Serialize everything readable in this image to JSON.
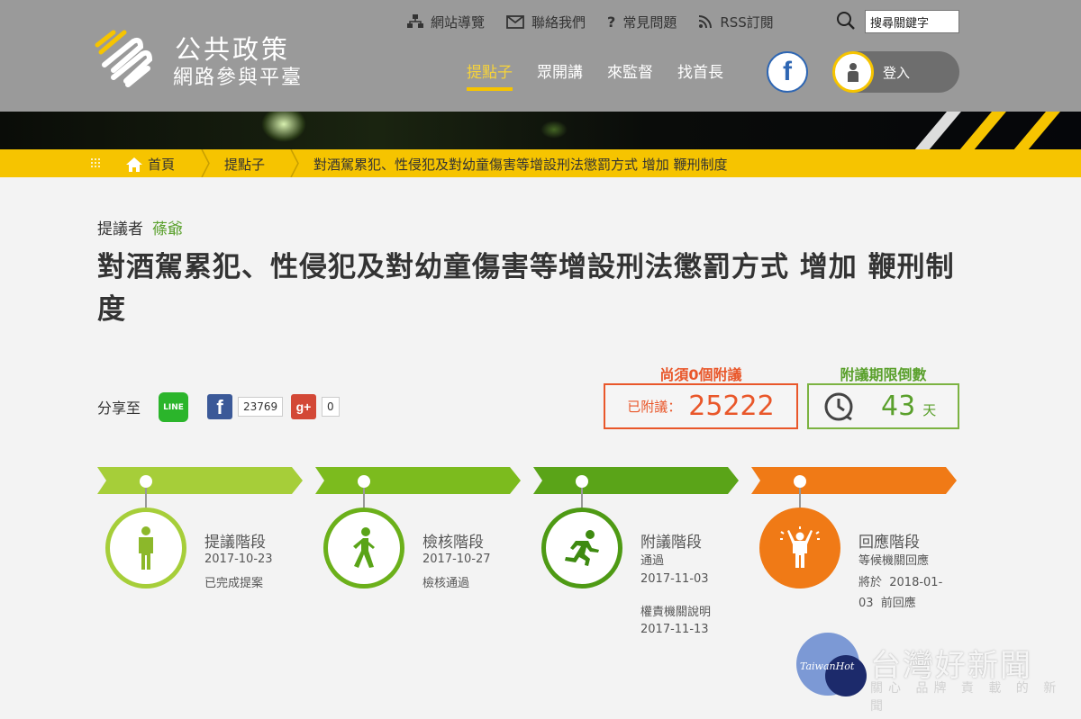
{
  "site": {
    "title_line1": "公共政策",
    "title_line2": "網路參與平臺"
  },
  "top_links": [
    {
      "label": "網站導覽",
      "icon": "sitemap-icon"
    },
    {
      "label": "聯絡我們",
      "icon": "envelope-icon"
    },
    {
      "label": "常見問題",
      "icon": "question-icon"
    },
    {
      "label": "RSS訂閱",
      "icon": "rss-icon"
    }
  ],
  "search": {
    "value": "搜尋關鍵字"
  },
  "nav": [
    {
      "label": "提點子",
      "active": true
    },
    {
      "label": "眾開講",
      "active": false
    },
    {
      "label": "來監督",
      "active": false
    },
    {
      "label": "找首長",
      "active": false
    }
  ],
  "facebook": {
    "label": "f"
  },
  "login": {
    "label": "登入"
  },
  "breadcrumb": {
    "home": "首頁",
    "section": "提點子",
    "current": "對酒駕累犯、性侵犯及對幼童傷害等增設刑法懲罰方式 增加 鞭刑制度"
  },
  "proposal": {
    "proposer_label": "提議者",
    "proposer_name": "蓧爺",
    "title": "對酒駕累犯、性侵犯及對幼童傷害等增設刑法懲罰方式 增加 鞭刑制度"
  },
  "share": {
    "label": "分享至",
    "line": "LINE",
    "facebook_icon": "f",
    "facebook_count": "23769",
    "gplus_icon": "g+",
    "gplus_count": "0"
  },
  "stats": {
    "need_label": "尚須0個附議",
    "seconded_label": "已附議：",
    "seconded_value": "25222",
    "countdown_label": "附議期限倒數",
    "countdown_value": "43",
    "countdown_unit": "天"
  },
  "stages": [
    {
      "name": "提議階段",
      "lines": [
        "2017-10-23",
        "已完成提案"
      ],
      "icon": "standing-person-icon",
      "color": "#a6ce39"
    },
    {
      "name": "檢核階段",
      "lines": [
        "2017-10-27",
        "檢核通過"
      ],
      "icon": "walking-person-icon",
      "color": "#7cbb1e"
    },
    {
      "name": "附議階段",
      "lines": [
        "通過",
        "2017-11-03",
        "權責機關說明",
        "2017-11-13"
      ],
      "icon": "running-person-icon",
      "color": "#5aa418"
    },
    {
      "name": "回應階段",
      "lines": [
        "等候機關回應",
        "將於  2018-01-",
        "03  前回應"
      ],
      "icon": "cheering-person-icon",
      "color": "#f07a16"
    }
  ],
  "watermark": {
    "mark": "TaiwanHot",
    "title": "台灣好新聞",
    "subtitle": "關心 品牌 責 載 的 新 聞"
  }
}
